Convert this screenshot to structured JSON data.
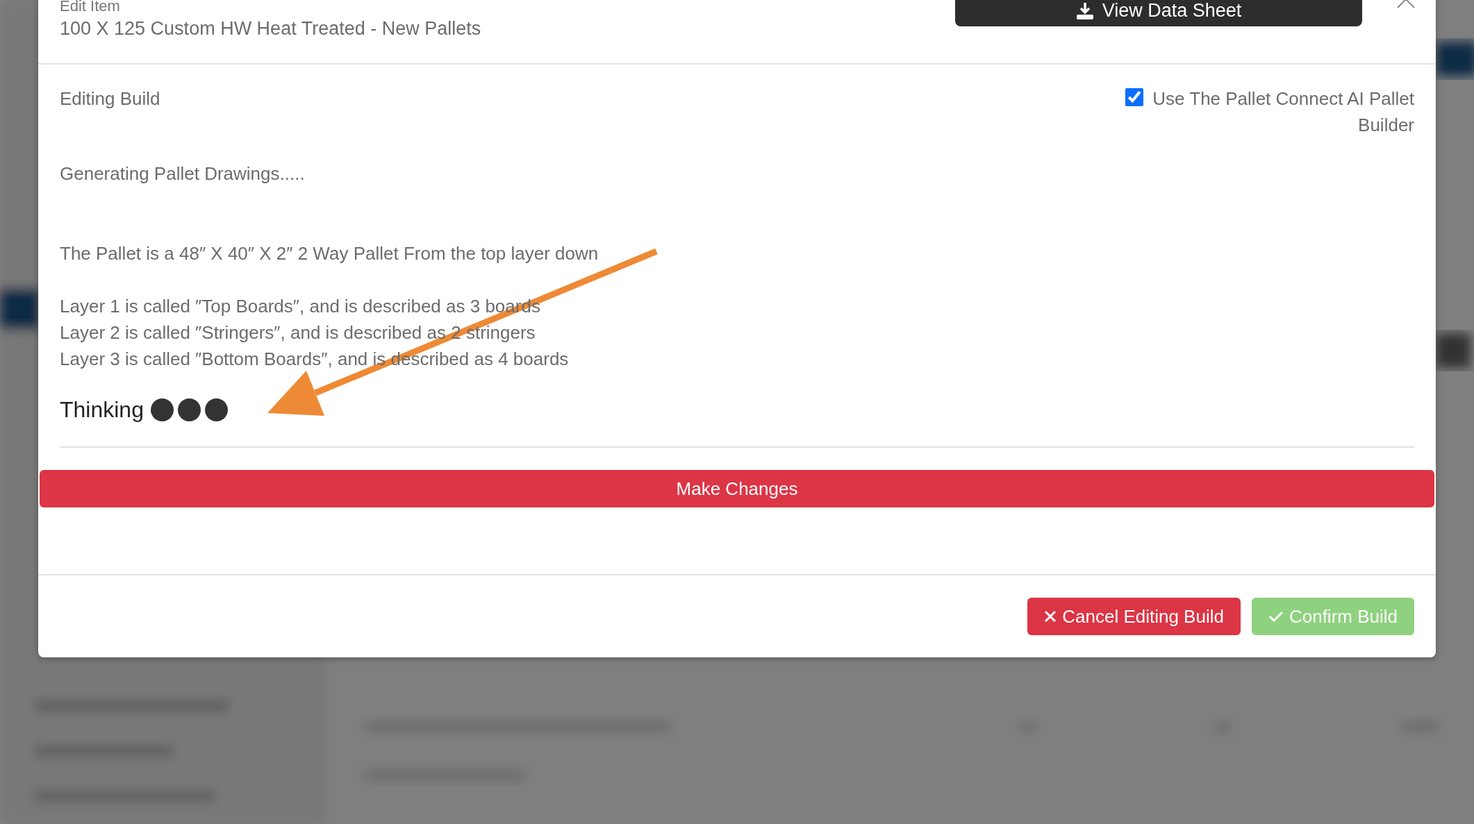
{
  "header": {
    "title": "Edit Item",
    "subtitle": "100 X 125 Custom HW Heat Treated - New Pallets",
    "data_sheet_button": "View Data Sheet"
  },
  "build": {
    "heading": "Editing Build",
    "ai_builder": {
      "label": "Use The Pallet Connect AI Pallet Builder",
      "checked": true
    },
    "status": "Generating Pallet Drawings.....",
    "summary": "The Pallet is a 48″ X 40″ X 2″ 2 Way Pallet From the top layer down",
    "layers": [
      "Layer 1 is called ″Top Boards″, and is described as 3 boards",
      "Layer 2 is called ″Stringers″, and is described as 2 stringers",
      "Layer 3 is called ″Bottom Boards″, and is described as 4 boards"
    ],
    "thinking": "Thinking"
  },
  "make_changes_button": "Make Changes",
  "footer": {
    "buttons": [
      {
        "kind": "cancel",
        "label": "Cancel Editing Build"
      },
      {
        "kind": "confirm",
        "label": "Confirm Build"
      }
    ]
  }
}
